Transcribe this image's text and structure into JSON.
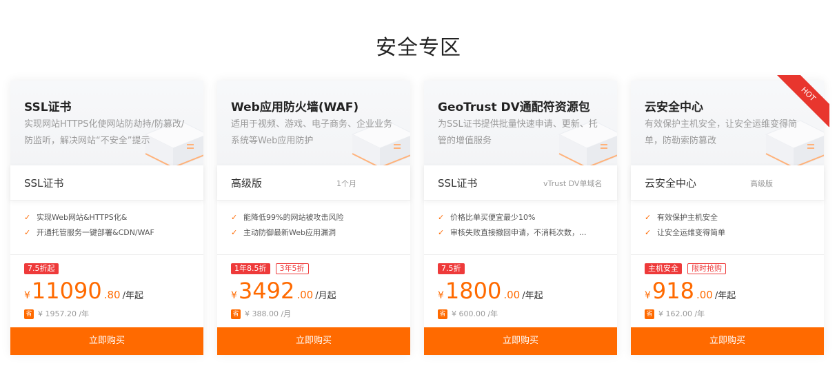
{
  "section_title": "安全专区",
  "accent_color": "#ff6a00",
  "badge_color": "#ee3a3a",
  "cards": [
    {
      "title": "SSL证书",
      "desc": "实现网站HTTPS化使网站防劫持/防篡改/防监听，解决网站“不安全”提示",
      "spec_main": "SSL证书",
      "spec_sub": "",
      "features": [
        "实现Web网站&HTTPS化&",
        "开通托管服务一键部署&CDN/WAF"
      ],
      "badges": [
        {
          "text": "7.5折起",
          "style": "solid"
        }
      ],
      "currency": "¥",
      "price_int": "11090",
      "price_dec": ".80",
      "price_unit": "/年起",
      "save_icon": "省",
      "save_text": "¥ 1957.20 /年",
      "buy_label": "立即购买",
      "hot": ""
    },
    {
      "title": "Web应用防火墙(WAF)",
      "desc": "适用于视频、游戏、电子商务、企业业务系统等Web应用防护",
      "spec_main": "高级版",
      "spec_sub": "1个月",
      "features": [
        "能降低99%的网站被攻击风险",
        "主动防御最新Web应用漏洞"
      ],
      "badges": [
        {
          "text": "1年8.5折",
          "style": "solid"
        },
        {
          "text": "3年5折",
          "style": "outline"
        }
      ],
      "currency": "¥",
      "price_int": "3492",
      "price_dec": ".00",
      "price_unit": "/月起",
      "save_icon": "省",
      "save_text": "¥ 388.00 /月",
      "buy_label": "立即购买",
      "hot": ""
    },
    {
      "title": "GeoTrust DV通配符资源包",
      "desc": "为SSL证书提供批量快速申请、更新、托管的增值服务",
      "spec_main": "SSL证书",
      "spec_sub": "vTrust DV单域名",
      "features": [
        "价格比单买便宜最少10%",
        "审核失败直接撤回申请，不消耗次数，..."
      ],
      "badges": [
        {
          "text": "7.5折",
          "style": "solid"
        }
      ],
      "currency": "¥",
      "price_int": "1800",
      "price_dec": ".00",
      "price_unit": "/年起",
      "save_icon": "省",
      "save_text": "¥ 600.00 /年",
      "buy_label": "立即购买",
      "hot": ""
    },
    {
      "title": "云安全中心",
      "desc": "有效保护主机安全，让安全运维变得简单，防勒索防篡改",
      "spec_main": "云安全中心",
      "spec_sub": "高级版",
      "features": [
        "有效保护主机安全",
        "让安全运维变得简单"
      ],
      "badges": [
        {
          "text": "主机安全",
          "style": "solid"
        },
        {
          "text": "限时抢购",
          "style": "outline"
        }
      ],
      "currency": "¥",
      "price_int": "918",
      "price_dec": ".00",
      "price_unit": "/年起",
      "save_icon": "省",
      "save_text": "¥ 162.00 /年",
      "buy_label": "立即购买",
      "hot": "HOT"
    }
  ]
}
